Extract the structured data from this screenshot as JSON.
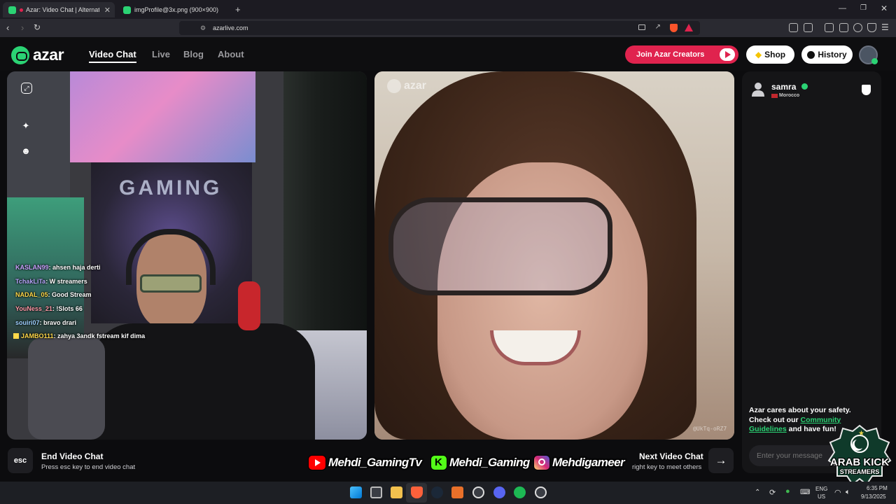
{
  "browser": {
    "tabs": [
      {
        "title": "Azar: Video Chat | Alternative",
        "active": true
      },
      {
        "title": "imgProfile@3x.png (900×900)",
        "active": false
      }
    ],
    "url": "azarlive.com"
  },
  "site": {
    "logo_text": "azar",
    "nav": [
      "Video Chat",
      "Live",
      "Blog",
      "About"
    ],
    "active_nav": "Video Chat",
    "join_button": "Join Azar Creators",
    "shop_button": "Shop",
    "history_button": "History"
  },
  "stream_chat": [
    {
      "user": "KASLAN99",
      "msg": ": ahsen haja derti",
      "color": "#c9a4ff"
    },
    {
      "user": "TchakLiTa",
      "msg": ": W streamers",
      "color": "#b9a8ff"
    },
    {
      "user": "NADAL_05",
      "msg": ": Good Stream",
      "color": "#ffd84a"
    },
    {
      "user": "YouNess_21",
      "msg": ": !Slots 66",
      "color": "#ff9aa8"
    },
    {
      "user": "souiri07",
      "msg": ": bravo drari",
      "color": "#9fd0ff"
    },
    {
      "user": "JAMBO111",
      "msg": ": zahya 3andk fstream kif dima",
      "color": "#ffd84a"
    }
  ],
  "video": {
    "watermark": "azar",
    "peer_id": "@UkTq-oRZ7"
  },
  "peer": {
    "name": "samra",
    "country": "Morocco"
  },
  "safety": {
    "line1": "Azar cares about your safety. Check out our ",
    "link": "Community Guidelines",
    "line2": " and have fun!"
  },
  "message_placeholder": "Enter your message",
  "bottom": {
    "esc_key": "esc",
    "end_title": "End Video Chat",
    "end_sub": "Press esc key to end video chat",
    "next_title": "Next Video Chat",
    "next_sub": "right key to meet others"
  },
  "socials": [
    {
      "name": "Mehdi_GamingTv",
      "color": "#ff0000"
    },
    {
      "name": "Mehdi_Gaming",
      "color": "#53fc18"
    },
    {
      "name": "Mehdigameer",
      "color": "#d62976"
    }
  ],
  "badge": {
    "line1": "ARAB KICK",
    "line2": "STREAMERS"
  },
  "taskbar": {
    "lang": "ENG",
    "region": "US",
    "time": "6:35 PM",
    "date": "9/13/2025"
  },
  "colors": {
    "accent_green": "#2bd374",
    "join_red": "#e0234e"
  }
}
